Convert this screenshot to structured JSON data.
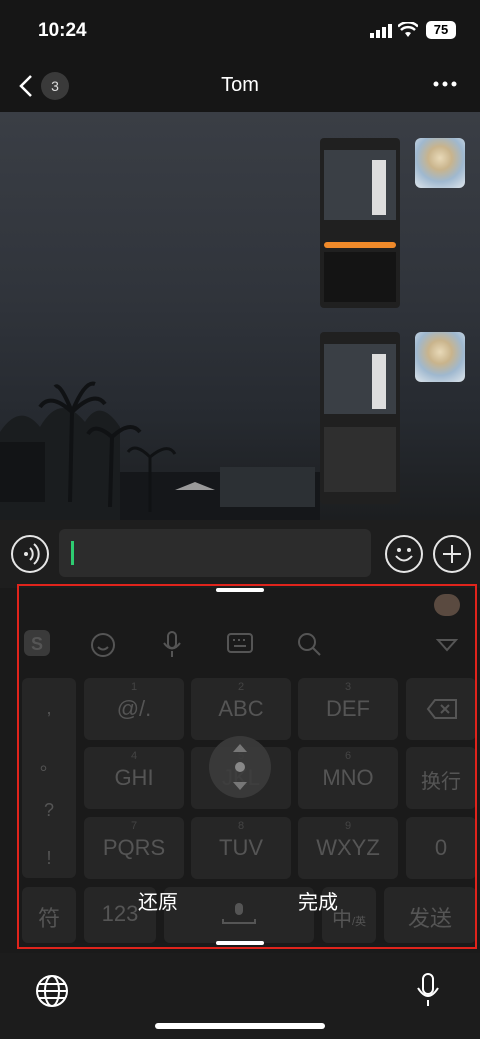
{
  "status": {
    "time": "10:24",
    "battery": "75"
  },
  "nav": {
    "title": "Tom",
    "badge": "3"
  },
  "keyboard": {
    "punct": [
      ",",
      "。",
      "?",
      "!"
    ],
    "keys": [
      {
        "num": "1",
        "label": "@/."
      },
      {
        "num": "2",
        "label": "ABC"
      },
      {
        "num": "3",
        "label": "DEF"
      },
      {
        "num": "4",
        "label": "GHI"
      },
      {
        "num": "5",
        "label": "JKL"
      },
      {
        "num": "6",
        "label": "MNO"
      },
      {
        "num": "7",
        "label": "PQRS"
      },
      {
        "num": "8",
        "label": "TUV"
      },
      {
        "num": "9",
        "label": "WXYZ"
      }
    ],
    "newline": "换行",
    "zero": "0",
    "symbol": "符",
    "num123": "123",
    "lang": "中",
    "lang_sub": "/英",
    "send": "发送"
  },
  "overlay": {
    "restore": "还原",
    "done": "完成"
  }
}
